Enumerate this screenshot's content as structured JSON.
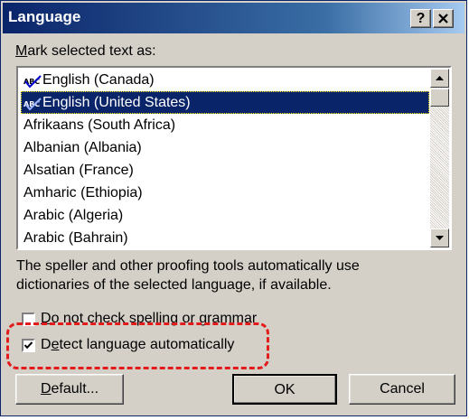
{
  "window": {
    "title": "Language",
    "help_button": "?",
    "close_button": "✕"
  },
  "mark_label": {
    "accel": "M",
    "rest": "ark selected text as:"
  },
  "languages": [
    {
      "label": "English (Canada)",
      "has_spell_icon": true,
      "selected": false
    },
    {
      "label": "English (United States)",
      "has_spell_icon": true,
      "selected": true
    },
    {
      "label": "Afrikaans (South Africa)",
      "has_spell_icon": false,
      "selected": false
    },
    {
      "label": "Albanian (Albania)",
      "has_spell_icon": false,
      "selected": false
    },
    {
      "label": "Alsatian (France)",
      "has_spell_icon": false,
      "selected": false
    },
    {
      "label": "Amharic (Ethiopia)",
      "has_spell_icon": false,
      "selected": false
    },
    {
      "label": "Arabic (Algeria)",
      "has_spell_icon": false,
      "selected": false
    },
    {
      "label": "Arabic (Bahrain)",
      "has_spell_icon": false,
      "selected": false
    }
  ],
  "spell_icon": {
    "text": "ABC",
    "name": "spell-check-icon"
  },
  "info_text": {
    "line1": "The speller and other proofing tools automatically use",
    "line2": "dictionaries of the selected language, if available."
  },
  "no_check": {
    "accel": "D",
    "rest": "o not check spelling or grammar",
    "checked": false
  },
  "detect": {
    "pre": "D",
    "accel": "e",
    "rest": "tect language automatically",
    "checked": true
  },
  "buttons": {
    "default_accel": "D",
    "default_rest": "efault...",
    "ok": "OK",
    "cancel": "Cancel"
  },
  "colors": {
    "selection": "#0a246a",
    "highlight_box": "#e31b1b",
    "face": "#d4d0c8"
  }
}
